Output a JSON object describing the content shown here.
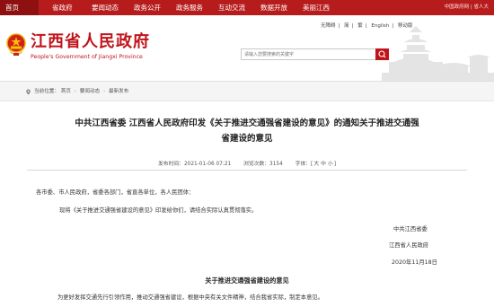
{
  "topnav": {
    "items": [
      "首页",
      "省政府",
      "要闻动态",
      "政务公开",
      "政务服务",
      "互动交流",
      "数据开放",
      "美丽江西"
    ],
    "right_text": "中国政府网 | 省人大"
  },
  "header": {
    "logo_cn": "江西省人民政府",
    "logo_en": "People's Government of Jiangxi Province",
    "links": [
      "无障碍",
      "简",
      "繁",
      "English",
      "移动版"
    ],
    "search_placeholder": "请输入您要搜索的关键字"
  },
  "breadcrumb": {
    "label": "当前位置：",
    "items": [
      "首页",
      "要闻动态",
      "最新发布"
    ]
  },
  "article": {
    "title_line1": "中共江西省委 江西省人民政府印发《关于推进交通强省建设的意见》的通知关于推进交通强",
    "title_line2": "省建设的意见",
    "meta_date": "发布时间：2021-01-06 07:21",
    "meta_views": "浏览次数：3154",
    "meta_font_label": "字体：",
    "meta_font_big": "大",
    "meta_font_mid": "中",
    "meta_font_small": "小",
    "addressee": "各市委、市人民政府，省委各部门，省直各单位，各人民团体：",
    "body1": "现将《关于推进交通强省建设的意见》印发给你们，请结合实际认真贯彻落实。",
    "sign1": "中共江西省委",
    "sign2": "江西省人民政府",
    "sign_date": "2020年11月18日",
    "subtitle": "关于推进交通强省建设的意见",
    "body2": "为更好发挥交通先行引领作用，推动交通强省建设，根据中央有关文件精神，结合我省实际，制定本意见。"
  }
}
